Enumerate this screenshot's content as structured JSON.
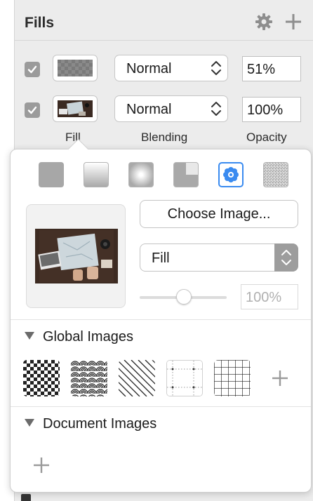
{
  "fills": {
    "title": "Fills",
    "header_icons": [
      "gear-icon",
      "plus-icon"
    ],
    "rows": [
      {
        "enabled": true,
        "swatch": "checkerboard-swatch",
        "blend_mode": "Normal",
        "opacity": "51%"
      },
      {
        "enabled": true,
        "swatch": "image-swatch",
        "blend_mode": "Normal",
        "opacity": "100%"
      }
    ],
    "column_labels": {
      "fill": "Fill",
      "blending": "Blending",
      "opacity": "Opacity"
    }
  },
  "popover": {
    "fill_types": [
      "solid-fill-icon",
      "linear-gradient-icon",
      "radial-gradient-icon",
      "angular-gradient-icon",
      "pattern-fill-icon",
      "noise-fill-icon"
    ],
    "selected_fill_type": "pattern-fill-icon",
    "choose_image_label": "Choose Image...",
    "fill_mode": "Fill",
    "tile_scale": "100%",
    "global_images_title": "Global Images",
    "global_patterns": [
      "checkerboard-pattern",
      "waves-pattern",
      "diagonal-stripes-pattern",
      "dotted-grid-pattern",
      "grid-pattern"
    ],
    "document_images_title": "Document Images"
  },
  "colors": {
    "accent": "#3a8bf0",
    "checkbox": "#9b9b9b"
  }
}
